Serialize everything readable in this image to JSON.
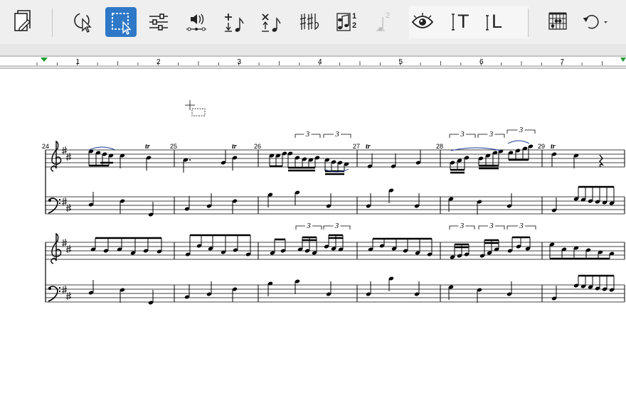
{
  "toolbar": {
    "tools": [
      {
        "id": "document-tool",
        "icon": "score-page-icon"
      },
      {
        "id": "selection-tool",
        "icon": "arrow-cursor-icon"
      },
      {
        "id": "marquee-selection-tool",
        "icon": "marquee-select-icon",
        "active": true
      },
      {
        "id": "mixer-tool",
        "icon": "sliders-icon"
      },
      {
        "id": "playback-tool",
        "icon": "speaker-playback-icon"
      },
      {
        "id": "add-note-tool",
        "icon": "add-note-icon"
      },
      {
        "id": "delete-note-tool",
        "icon": "delete-note-icon"
      },
      {
        "id": "accidentals-tool",
        "icon": "sharp-flat-icon"
      },
      {
        "id": "voice-tool",
        "icon": "voice-numbers-icon",
        "label_top": "1",
        "label_bottom": "2"
      },
      {
        "id": "voice-2-tool",
        "icon": "voice-2-disabled-icon",
        "label": "2",
        "disabled": true
      },
      {
        "id": "view-tool",
        "icon": "eye-icon"
      },
      {
        "id": "text-tool",
        "icon": "text-cursor-icon",
        "label": "T"
      },
      {
        "id": "lyrics-tool",
        "icon": "lyrics-cursor-icon",
        "label": "L"
      },
      {
        "id": "chord-diagram-tool",
        "icon": "chord-grid-icon"
      },
      {
        "id": "undo-tool",
        "icon": "undo-arrow-icon"
      }
    ],
    "accent_color": "#2e78c7"
  },
  "ruler": {
    "numbers": [
      "1",
      "2",
      "3",
      "4",
      "5",
      "6",
      "7"
    ],
    "marker_color": "#1e9e2e"
  },
  "score": {
    "measure_numbers": [
      "24",
      "25",
      "26",
      "27",
      "28",
      "29"
    ],
    "tuplet_label": "3",
    "trill_label": "tr"
  }
}
